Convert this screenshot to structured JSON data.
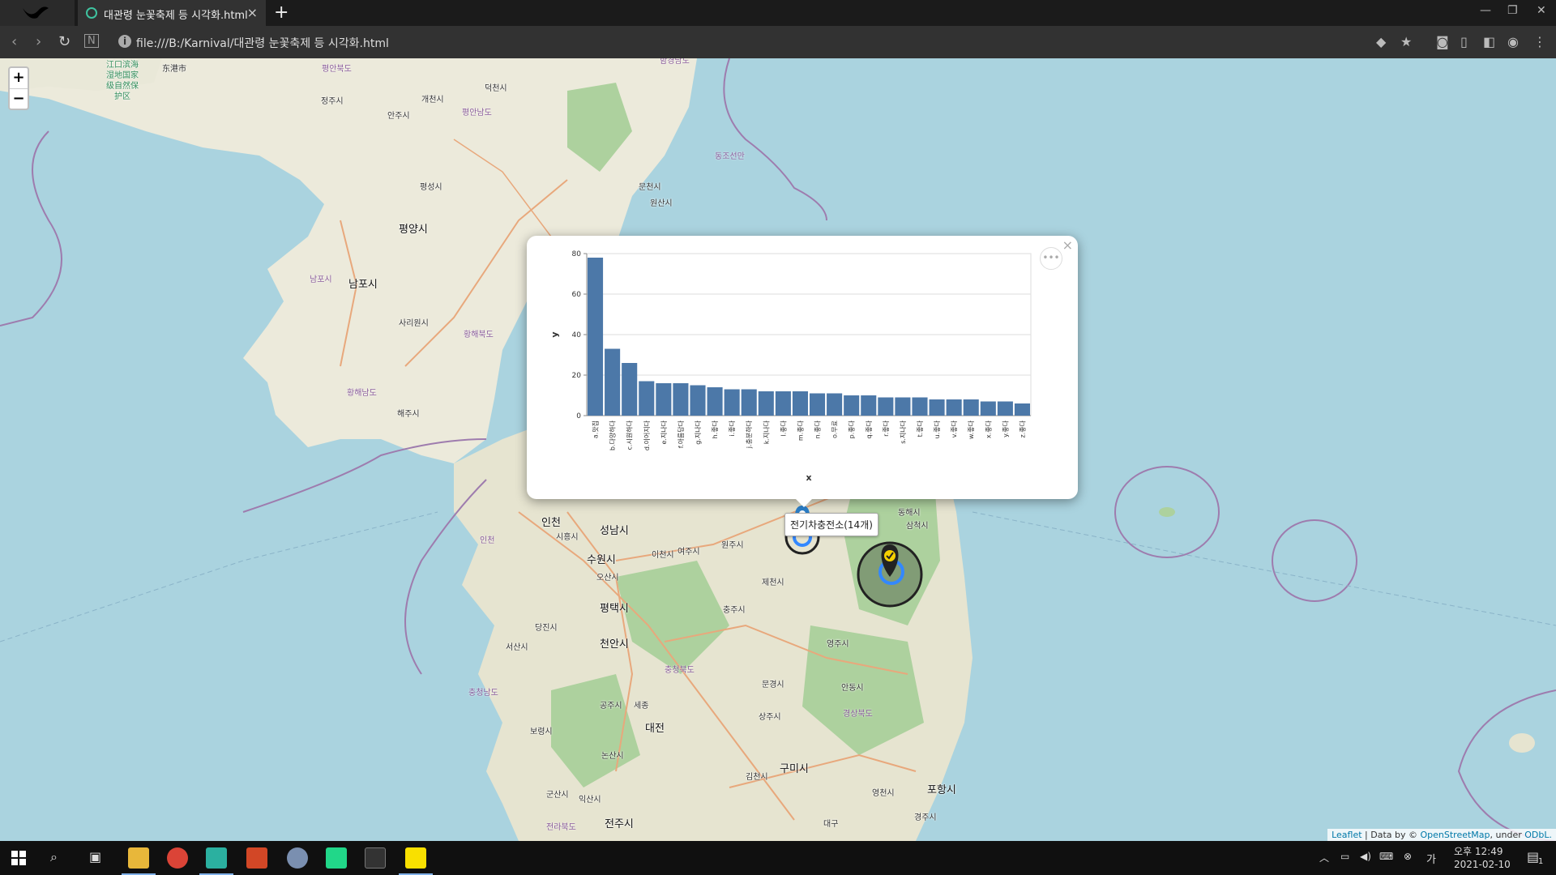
{
  "browser": {
    "tab_title": "대관령 눈꽃축제 등 시각화.html",
    "url": "file:///B:/Karnival/대관령 눈꽃축제 등 시각화.html"
  },
  "map": {
    "zoom_in": "+",
    "zoom_out": "−",
    "labels": [
      {
        "text": "江口滨海湿地国家级自然保护区",
        "kind": "city"
      },
      {
        "text": "东港市",
        "kind": "city"
      },
      {
        "text": "평안북도",
        "kind": "region"
      },
      {
        "text": "정주시",
        "kind": "city"
      },
      {
        "text": "안주시",
        "kind": "city"
      },
      {
        "text": "개천시",
        "kind": "city"
      },
      {
        "text": "덕천시",
        "kind": "city"
      },
      {
        "text": "평안남도",
        "kind": "region"
      },
      {
        "text": "함경남도",
        "kind": "region"
      },
      {
        "text": "평성시",
        "kind": "city"
      },
      {
        "text": "평양시",
        "kind": "big"
      },
      {
        "text": "남포시",
        "kind": "region"
      },
      {
        "text": "남포시",
        "kind": "big"
      },
      {
        "text": "사리원시",
        "kind": "city"
      },
      {
        "text": "황해북도",
        "kind": "region"
      },
      {
        "text": "황해남도",
        "kind": "region"
      },
      {
        "text": "해주시",
        "kind": "city"
      },
      {
        "text": "동조선만",
        "kind": "region"
      },
      {
        "text": "문천시",
        "kind": "city"
      },
      {
        "text": "원산시",
        "kind": "city"
      },
      {
        "text": "동해시",
        "kind": "city"
      },
      {
        "text": "삼척시",
        "kind": "city"
      },
      {
        "text": "인천",
        "kind": "big"
      },
      {
        "text": "시흥시",
        "kind": "city"
      },
      {
        "text": "성남시",
        "kind": "big"
      },
      {
        "text": "이천시",
        "kind": "city"
      },
      {
        "text": "여주시",
        "kind": "city"
      },
      {
        "text": "원주시",
        "kind": "city"
      },
      {
        "text": "인천",
        "kind": "region"
      },
      {
        "text": "수원시",
        "kind": "big"
      },
      {
        "text": "오산시",
        "kind": "city"
      },
      {
        "text": "평택시",
        "kind": "big"
      },
      {
        "text": "제천시",
        "kind": "city"
      },
      {
        "text": "충주시",
        "kind": "city"
      },
      {
        "text": "당진시",
        "kind": "city"
      },
      {
        "text": "천안시",
        "kind": "big"
      },
      {
        "text": "서산시",
        "kind": "city"
      },
      {
        "text": "영주시",
        "kind": "city"
      },
      {
        "text": "충청북도",
        "kind": "region"
      },
      {
        "text": "충청남도",
        "kind": "region"
      },
      {
        "text": "문경시",
        "kind": "city"
      },
      {
        "text": "안동시",
        "kind": "city"
      },
      {
        "text": "공주시",
        "kind": "city"
      },
      {
        "text": "세종",
        "kind": "city"
      },
      {
        "text": "상주시",
        "kind": "city"
      },
      {
        "text": "경상북도",
        "kind": "region"
      },
      {
        "text": "보령시",
        "kind": "city"
      },
      {
        "text": "대전",
        "kind": "big"
      },
      {
        "text": "논산시",
        "kind": "city"
      },
      {
        "text": "구미시",
        "kind": "big"
      },
      {
        "text": "김천시",
        "kind": "city"
      },
      {
        "text": "포항시",
        "kind": "big"
      },
      {
        "text": "군산시",
        "kind": "city"
      },
      {
        "text": "익산시",
        "kind": "city"
      },
      {
        "text": "영천시",
        "kind": "city"
      },
      {
        "text": "전라북도",
        "kind": "region"
      },
      {
        "text": "전주시",
        "kind": "big"
      },
      {
        "text": "대구",
        "kind": "city"
      },
      {
        "text": "경주시",
        "kind": "city"
      }
    ],
    "tooltip": "전기차충전소(14개)",
    "attribution": {
      "leaflet": "Leaflet",
      "data_by": " | Data by © ",
      "osm": "OpenStreetMap",
      "under": ", under ",
      "odbl": "ODbL."
    }
  },
  "popup": {
    "close": "×",
    "menu": "•••"
  },
  "chart_data": {
    "type": "bar",
    "xlabel": "x",
    "ylabel": "y",
    "ylim": [
      0,
      80
    ],
    "yticks": [
      0,
      20,
      40,
      60,
      80
    ],
    "categories": [
      "a.맛집",
      "b.다양하다",
      "c.시원하다",
      "d.이어지다",
      "e.지나다",
      "f.아름답다",
      "g.지나다",
      "h.좋다",
      "i.좋다",
      "j.충분하다",
      "k.지나다",
      "l.좋다",
      "m.좋다",
      "n.좋다",
      "o.무료",
      "p.좋다",
      "q.좋다",
      "r.좋다",
      "s.지나다",
      "t.좋다",
      "u.좋다",
      "v.좋다",
      "w.좋다",
      "x.좋다",
      "y.좋다",
      "z.좋다"
    ],
    "values": [
      78,
      33,
      26,
      17,
      16,
      16,
      15,
      14,
      13,
      13,
      12,
      12,
      12,
      11,
      11,
      10,
      10,
      9,
      9,
      9,
      8,
      8,
      8,
      7,
      7,
      6
    ],
    "color": "#4c78a8",
    "grid": true
  },
  "taskbar": {
    "time": "오후 12:49",
    "date": "2021-02-10",
    "lang": "가",
    "notif_count": "1"
  }
}
